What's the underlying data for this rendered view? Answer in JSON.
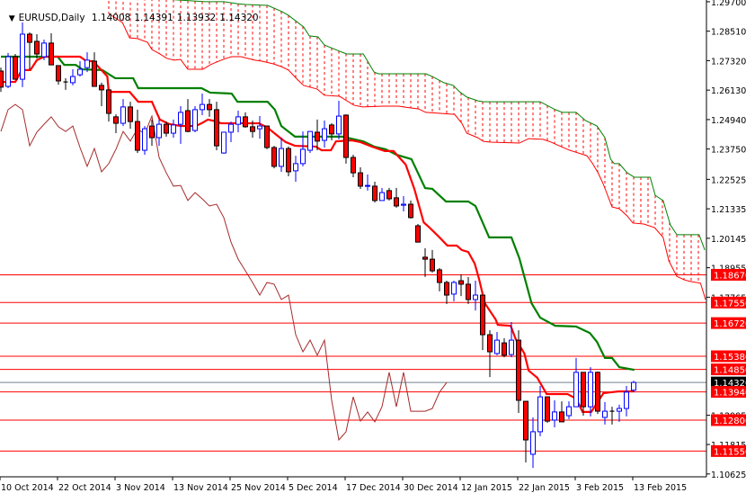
{
  "header": {
    "symbol_label": "EURUSD,Daily",
    "open": "1.14008",
    "high": "1.14391",
    "low": "1.13932",
    "close": "1.14320"
  },
  "colors": {
    "bull": "#0000ff",
    "bear": "#ff0000",
    "tenkan": "#ff0000",
    "kijun": "#008000",
    "chikou": "#a52a2a",
    "cloud": "#ff0000",
    "cloud_top": "#008000",
    "level": "#ff0000",
    "current": "#708090"
  },
  "chart_data": {
    "type": "candlestick",
    "title": "EURUSD,Daily",
    "price_range": [
      1.105,
      1.2977
    ],
    "price_ticks": [
      "1.29700",
      "1.28510",
      "1.27320",
      "1.26130",
      "1.24940",
      "1.23750",
      "1.22525",
      "1.21335",
      "1.20145",
      "1.18955",
      "1.17765",
      "1.12995",
      "1.11815",
      "1.10625"
    ],
    "date_labels": [
      {
        "bar": 0,
        "label": "10 Oct 2014"
      },
      {
        "bar": 8,
        "label": "22 Oct 2014"
      },
      {
        "bar": 16,
        "label": "3 Nov 2014"
      },
      {
        "bar": 24,
        "label": "13 Nov 2014"
      },
      {
        "bar": 32,
        "label": "25 Nov 2014"
      },
      {
        "bar": 40,
        "label": "5 Dec 2014"
      },
      {
        "bar": 48,
        "label": "17 Dec 2014"
      },
      {
        "bar": 56,
        "label": "30 Dec 2014"
      },
      {
        "bar": 64,
        "label": "12 Jan 2015"
      },
      {
        "bar": 72,
        "label": "22 Jan 2015"
      },
      {
        "bar": 80,
        "label": "3 Feb 2015"
      },
      {
        "bar": 88,
        "label": "13 Feb 2015"
      }
    ],
    "candles_ohlc": [
      [
        1.269,
        1.2704,
        1.2606,
        1.2625
      ],
      [
        1.2628,
        1.2763,
        1.2621,
        1.2748
      ],
      [
        1.2748,
        1.2759,
        1.2657,
        1.2657
      ],
      [
        1.2657,
        1.2886,
        1.2625,
        1.2839
      ],
      [
        1.2839,
        1.2846,
        1.2697,
        1.2806
      ],
      [
        1.281,
        1.2839,
        1.2741,
        1.2759
      ],
      [
        1.2748,
        1.2817,
        1.2734,
        1.2803
      ],
      [
        1.2803,
        1.2843,
        1.2715,
        1.2715
      ],
      [
        1.2712,
        1.2712,
        1.2635,
        1.265
      ],
      [
        1.2646,
        1.2661,
        1.2614,
        1.2646
      ],
      [
        1.2643,
        1.2697,
        1.2632,
        1.2668
      ],
      [
        1.2675,
        1.273,
        1.2668,
        1.2697
      ],
      [
        1.2704,
        1.2766,
        1.2686,
        1.2734
      ],
      [
        1.273,
        1.2766,
        1.2628,
        1.2628
      ],
      [
        1.2632,
        1.2643,
        1.2548,
        1.2614
      ],
      [
        1.2614,
        1.2614,
        1.2486,
        1.2519
      ],
      [
        1.2505,
        1.2515,
        1.2439,
        1.2479
      ],
      [
        1.2479,
        1.2577,
        1.2468,
        1.2545
      ],
      [
        1.2545,
        1.2566,
        1.2457,
        1.2486
      ],
      [
        1.2486,
        1.2534,
        1.2359,
        1.237
      ],
      [
        1.237,
        1.2468,
        1.2352,
        1.2457
      ],
      [
        1.2468,
        1.2494,
        1.2388,
        1.2421
      ],
      [
        1.2421,
        1.2494,
        1.2388,
        1.2475
      ],
      [
        1.2475,
        1.2486,
        1.2425,
        1.2439
      ],
      [
        1.2439,
        1.2494,
        1.2421,
        1.2472
      ],
      [
        1.2475,
        1.2548,
        1.2396,
        1.2523
      ],
      [
        1.253,
        1.2577,
        1.2443,
        1.2446
      ],
      [
        1.245,
        1.2548,
        1.2443,
        1.2534
      ],
      [
        1.2534,
        1.2599,
        1.2512,
        1.2555
      ],
      [
        1.2555,
        1.2577,
        1.2505,
        1.2534
      ],
      [
        1.2534,
        1.2566,
        1.237,
        1.2388
      ],
      [
        1.2359,
        1.2443,
        1.2356,
        1.2443
      ],
      [
        1.2443,
        1.2486,
        1.2403,
        1.2475
      ],
      [
        1.2475,
        1.253,
        1.2443,
        1.2505
      ],
      [
        1.2505,
        1.2523,
        1.2461,
        1.2465
      ],
      [
        1.2465,
        1.249,
        1.2421,
        1.2446
      ],
      [
        1.2457,
        1.2508,
        1.2417,
        1.2468
      ],
      [
        1.2468,
        1.2468,
        1.2374,
        1.2381
      ],
      [
        1.2381,
        1.2388,
        1.2297,
        1.2305
      ],
      [
        1.2305,
        1.2421,
        1.2283,
        1.2377
      ],
      [
        1.2377,
        1.2385,
        1.2265,
        1.2283
      ],
      [
        1.2287,
        1.2348,
        1.2243,
        1.2316
      ],
      [
        1.2316,
        1.2446,
        1.2305,
        1.2374
      ],
      [
        1.237,
        1.2446,
        1.2359,
        1.2446
      ],
      [
        1.2443,
        1.2494,
        1.237,
        1.2407
      ],
      [
        1.241,
        1.249,
        1.2381,
        1.2457
      ],
      [
        1.2472,
        1.2479,
        1.241,
        1.2436
      ],
      [
        1.2436,
        1.257,
        1.2414,
        1.2508
      ],
      [
        1.2512,
        1.2515,
        1.2316,
        1.2341
      ],
      [
        1.2341,
        1.2352,
        1.2261,
        1.2279
      ],
      [
        1.2279,
        1.2301,
        1.2214,
        1.2225
      ],
      [
        1.2225,
        1.2272,
        1.2207,
        1.2228
      ],
      [
        1.2225,
        1.2243,
        1.2159,
        1.2167
      ],
      [
        1.2167,
        1.2218,
        1.2167,
        1.2199
      ],
      [
        1.2207,
        1.2218,
        1.2167,
        1.2174
      ],
      [
        1.2178,
        1.2218,
        1.2138,
        1.2145
      ],
      [
        1.2148,
        1.2185,
        1.2123,
        1.2152
      ],
      [
        1.2152,
        1.2167,
        1.2094,
        1.2098
      ],
      [
        1.2065,
        1.2072,
        1.1999,
        1.1999
      ],
      [
        1.1938,
        1.1974,
        1.1858,
        1.193
      ],
      [
        1.193,
        1.1967,
        1.1876,
        1.1883
      ],
      [
        1.1887,
        1.1894,
        1.18,
        1.1836
      ],
      [
        1.1836,
        1.1843,
        1.1749,
        1.1785
      ],
      [
        1.1789,
        1.1843,
        1.176,
        1.1836
      ],
      [
        1.1843,
        1.1869,
        1.1781,
        1.1829
      ],
      [
        1.1829,
        1.1858,
        1.1749,
        1.1767
      ],
      [
        1.1767,
        1.1843,
        1.1723,
        1.1785
      ],
      [
        1.1785,
        1.1785,
        1.1563,
        1.1625
      ],
      [
        1.1625,
        1.1643,
        1.1454,
        1.1556
      ],
      [
        1.1549,
        1.1636,
        1.1542,
        1.1603
      ],
      [
        1.1592,
        1.1611,
        1.1534,
        1.1542
      ],
      [
        1.1545,
        1.1676,
        1.1534,
        1.1603
      ],
      [
        1.1603,
        1.1643,
        1.1309,
        1.136
      ],
      [
        1.1356,
        1.1356,
        1.1109,
        1.12
      ],
      [
        1.1142,
        1.1291,
        1.1087,
        1.1233
      ],
      [
        1.1233,
        1.1418,
        1.1215,
        1.1374
      ],
      [
        1.1374,
        1.1374,
        1.1269,
        1.1276
      ],
      [
        1.128,
        1.136,
        1.1251,
        1.1313
      ],
      [
        1.1313,
        1.1356,
        1.1273,
        1.1273
      ],
      [
        1.1298,
        1.1356,
        1.1284,
        1.1334
      ],
      [
        1.1334,
        1.1531,
        1.1334,
        1.1473
      ],
      [
        1.1473,
        1.1473,
        1.1298,
        1.1334
      ],
      [
        1.1334,
        1.1494,
        1.1295,
        1.1473
      ],
      [
        1.1473,
        1.1476,
        1.1305,
        1.1316
      ],
      [
        1.1291,
        1.1353,
        1.1262,
        1.1316
      ],
      [
        1.1316,
        1.1334,
        1.1262,
        1.1316
      ],
      [
        1.1316,
        1.1342,
        1.1273,
        1.1327
      ],
      [
        1.1327,
        1.1418,
        1.1295,
        1.1393
      ],
      [
        1.14008,
        1.14391,
        1.13932,
        1.1432
      ]
    ],
    "tenkan_sen": [
      [
        0,
        1.2646
      ],
      [
        2,
        1.2646
      ],
      [
        2.9,
        1.2694
      ],
      [
        4.1,
        1.2694
      ],
      [
        5,
        1.2734
      ],
      [
        6,
        1.2748
      ],
      [
        11,
        1.2748
      ],
      [
        11.9,
        1.273
      ],
      [
        12.8,
        1.273
      ],
      [
        13.4,
        1.2712
      ],
      [
        14.8,
        1.2668
      ],
      [
        15,
        1.2606
      ],
      [
        17.9,
        1.2606
      ],
      [
        19.1,
        1.2566
      ],
      [
        21,
        1.2566
      ],
      [
        22.1,
        1.2494
      ],
      [
        23.4,
        1.2476
      ],
      [
        25,
        1.2468
      ],
      [
        27.1,
        1.2468
      ],
      [
        27.9,
        1.2479
      ],
      [
        28.8,
        1.2494
      ],
      [
        30,
        1.2486
      ],
      [
        30.6,
        1.2479
      ],
      [
        35.9,
        1.2479
      ],
      [
        37.1,
        1.2461
      ],
      [
        38.8,
        1.2421
      ],
      [
        39.6,
        1.2403
      ],
      [
        40.9,
        1.2388
      ],
      [
        43.8,
        1.2385
      ],
      [
        44.6,
        1.237
      ],
      [
        45.9,
        1.237
      ],
      [
        46.6,
        1.2406
      ],
      [
        48.8,
        1.241
      ],
      [
        50,
        1.2403
      ],
      [
        51.6,
        1.2385
      ],
      [
        53.4,
        1.2367
      ],
      [
        54.6,
        1.2367
      ],
      [
        56.3,
        1.2312
      ],
      [
        57.5,
        1.2214
      ],
      [
        58.8,
        1.2079
      ],
      [
        59.6,
        1.2058
      ],
      [
        60.9,
        1.2021
      ],
      [
        62.1,
        1.1985
      ],
      [
        63.4,
        1.1985
      ],
      [
        64.1,
        1.1967
      ],
      [
        65,
        1.1959
      ],
      [
        65.9,
        1.1912
      ],
      [
        66.5,
        1.185
      ],
      [
        67.3,
        1.1752
      ],
      [
        68.8,
        1.1687
      ],
      [
        69.1,
        1.1665
      ],
      [
        70.9,
        1.1661
      ],
      [
        71.6,
        1.1607
      ],
      [
        72.8,
        1.1549
      ],
      [
        73.4,
        1.148
      ],
      [
        74.6,
        1.1451
      ],
      [
        75.9,
        1.1385
      ],
      [
        78.8,
        1.1385
      ],
      [
        80,
        1.1367
      ],
      [
        80.9,
        1.1313
      ],
      [
        82.1,
        1.1313
      ],
      [
        83.8,
        1.1389
      ],
      [
        85.9,
        1.1396
      ],
      [
        88.1,
        1.1396
      ]
    ],
    "kijun_sen": [
      [
        0,
        1.2748
      ],
      [
        7.9,
        1.2748
      ],
      [
        8.8,
        1.2715
      ],
      [
        10.4,
        1.2715
      ],
      [
        11.3,
        1.2697
      ],
      [
        14.1,
        1.2694
      ],
      [
        15.9,
        1.2661
      ],
      [
        18.4,
        1.2661
      ],
      [
        19.1,
        1.2621
      ],
      [
        27.9,
        1.2621
      ],
      [
        29.1,
        1.2603
      ],
      [
        32.1,
        1.2599
      ],
      [
        32.9,
        1.2566
      ],
      [
        37.1,
        1.2566
      ],
      [
        38.1,
        1.2534
      ],
      [
        39,
        1.2468
      ],
      [
        40.9,
        1.2425
      ],
      [
        47.5,
        1.2425
      ],
      [
        50.4,
        1.2406
      ],
      [
        51.9,
        1.2385
      ],
      [
        53.5,
        1.2374
      ],
      [
        55,
        1.2352
      ],
      [
        57.1,
        1.2334
      ],
      [
        59,
        1.2217
      ],
      [
        60,
        1.2214
      ],
      [
        61.9,
        1.2163
      ],
      [
        65,
        1.2163
      ],
      [
        66,
        1.2145
      ],
      [
        67.9,
        1.2018
      ],
      [
        71,
        1.2018
      ],
      [
        72.1,
        1.1934
      ],
      [
        73.8,
        1.1752
      ],
      [
        75,
        1.1694
      ],
      [
        77.1,
        1.1661
      ],
      [
        80,
        1.1658
      ],
      [
        81.9,
        1.1632
      ],
      [
        82.9,
        1.1596
      ],
      [
        84,
        1.1531
      ],
      [
        85,
        1.1531
      ],
      [
        86,
        1.1494
      ],
      [
        88.1,
        1.1483
      ]
    ],
    "senkou_span_b": [
      [
        15,
        1.2995
      ],
      [
        28.4,
        1.297
      ],
      [
        31,
        1.297
      ],
      [
        32.9,
        1.2962
      ],
      [
        34,
        1.2959
      ],
      [
        37.1,
        1.2955
      ],
      [
        39.1,
        1.293
      ],
      [
        40,
        1.2915
      ],
      [
        42.1,
        1.2868
      ],
      [
        42.9,
        1.2832
      ],
      [
        44.1,
        1.2828
      ],
      [
        45,
        1.2795
      ],
      [
        47.1,
        1.277
      ],
      [
        48.1,
        1.2759
      ],
      [
        50.4,
        1.2759
      ],
      [
        51.9,
        1.2686
      ],
      [
        52.5,
        1.2679
      ],
      [
        59.1,
        1.2679
      ],
      [
        60,
        1.2668
      ],
      [
        61.6,
        1.2643
      ],
      [
        62.9,
        1.2632
      ],
      [
        63.8,
        1.2606
      ],
      [
        64.8,
        1.2585
      ],
      [
        66.3,
        1.257
      ],
      [
        67.1,
        1.2566
      ],
      [
        75,
        1.2566
      ],
      [
        77.1,
        1.2534
      ],
      [
        78.1,
        1.2523
      ],
      [
        80,
        1.2523
      ],
      [
        81.3,
        1.249
      ],
      [
        82.9,
        1.2468
      ],
      [
        84,
        1.2421
      ],
      [
        84.8,
        1.2334
      ],
      [
        85.3,
        1.2316
      ],
      [
        86,
        1.2316
      ],
      [
        87.1,
        1.2279
      ],
      [
        88.1,
        1.2261
      ],
      [
        90.3,
        1.2261
      ],
      [
        91,
        1.2188
      ],
      [
        92.1,
        1.2167
      ],
      [
        93.1,
        1.2069
      ],
      [
        94,
        1.2029
      ],
      [
        97.1,
        1.2029
      ],
      [
        97.9,
        1.1967
      ]
    ],
    "senkou_span_a": [
      [
        15,
        1.2922
      ],
      [
        16.9,
        1.2886
      ],
      [
        17.9,
        1.2824
      ],
      [
        19,
        1.2821
      ],
      [
        20.4,
        1.2806
      ],
      [
        21,
        1.2777
      ],
      [
        22.1,
        1.2759
      ],
      [
        23.1,
        1.2741
      ],
      [
        24.1,
        1.2734
      ],
      [
        25,
        1.2737
      ],
      [
        26,
        1.2697
      ],
      [
        28.1,
        1.2697
      ],
      [
        29.1,
        1.2715
      ],
      [
        30.3,
        1.273
      ],
      [
        31.3,
        1.2741
      ],
      [
        32.1,
        1.2748
      ],
      [
        33.4,
        1.2748
      ],
      [
        35.3,
        1.2734
      ],
      [
        36.3,
        1.273
      ],
      [
        37.9,
        1.2719
      ],
      [
        39,
        1.2708
      ],
      [
        40,
        1.2694
      ],
      [
        41.3,
        1.2654
      ],
      [
        42.1,
        1.2632
      ],
      [
        44,
        1.2617
      ],
      [
        45,
        1.2592
      ],
      [
        47.1,
        1.2588
      ],
      [
        49.1,
        1.2552
      ],
      [
        50.3,
        1.2545
      ],
      [
        53.1,
        1.2548
      ],
      [
        55.3,
        1.2548
      ],
      [
        56,
        1.2545
      ],
      [
        58.1,
        1.2537
      ],
      [
        59.1,
        1.2523
      ],
      [
        63.1,
        1.2515
      ],
      [
        64.1,
        1.2479
      ],
      [
        64.8,
        1.2439
      ],
      [
        66.3,
        1.2421
      ],
      [
        67.1,
        1.2406
      ],
      [
        68.1,
        1.2403
      ],
      [
        72.1,
        1.2399
      ],
      [
        73.4,
        1.2417
      ],
      [
        75.4,
        1.2414
      ],
      [
        76.5,
        1.2403
      ],
      [
        77.9,
        1.2385
      ],
      [
        79.1,
        1.237
      ],
      [
        81.5,
        1.2348
      ],
      [
        82.3,
        1.2316
      ],
      [
        83.1,
        1.2276
      ],
      [
        83.8,
        1.2232
      ],
      [
        85,
        1.2141
      ],
      [
        86,
        1.2134
      ],
      [
        87.1,
        1.2105
      ],
      [
        87.9,
        1.2076
      ],
      [
        89.4,
        1.2072
      ],
      [
        90.9,
        1.2058
      ],
      [
        92.1,
        1.2018
      ],
      [
        92.9,
        1.1923
      ],
      [
        94,
        1.1861
      ],
      [
        95,
        1.1847
      ],
      [
        95.9,
        1.184
      ],
      [
        97.3,
        1.1833
      ],
      [
        98,
        1.1767
      ]
    ],
    "chikou_shift_bars": 26,
    "levels": [
      {
        "price": 1.1867,
        "label": "1.18670",
        "kind": "level"
      },
      {
        "price": 1.1755,
        "label": "1.17550",
        "kind": "level"
      },
      {
        "price": 1.1672,
        "label": "1.16720",
        "kind": "level"
      },
      {
        "price": 1.1538,
        "label": "1.15380",
        "kind": "level"
      },
      {
        "price": 1.1485,
        "label": "1.14850",
        "kind": "level"
      },
      {
        "price": 1.1432,
        "label": "1.14320",
        "kind": "current"
      },
      {
        "price": 1.1394,
        "label": "1.13940",
        "kind": "level"
      },
      {
        "price": 1.128,
        "label": "1.12800",
        "kind": "level"
      },
      {
        "price": 1.1155,
        "label": "1.11550",
        "kind": "level"
      }
    ]
  }
}
